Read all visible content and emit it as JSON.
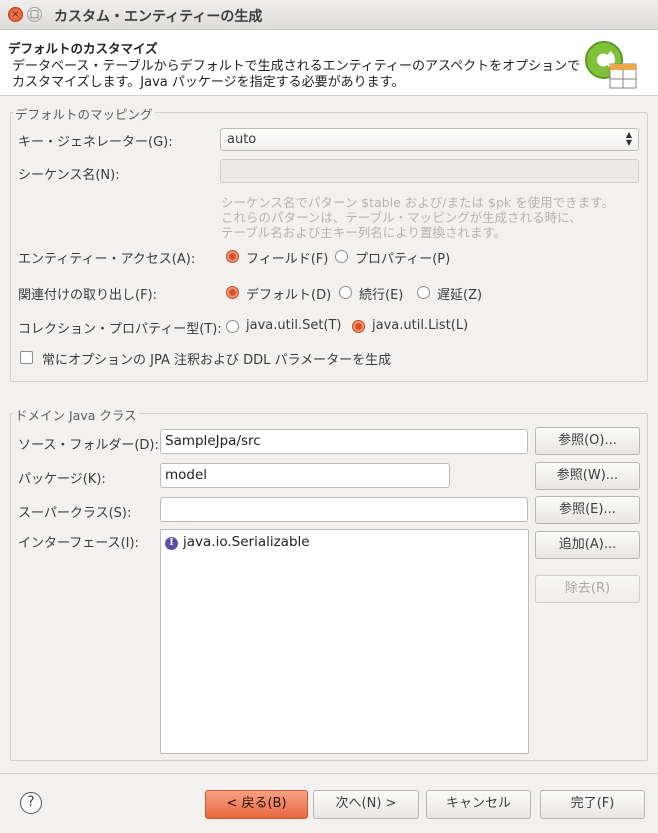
{
  "window": {
    "title": "カスタム・エンティティーの生成",
    "close_glyph": "×",
    "max_glyph": "□"
  },
  "banner": {
    "title": "デフォルトのカスタマイズ",
    "description": "データベース・テーブルからデフォルトで生成されるエンティティーのアスペクトをオプションでカスタマイズします。Java パッケージを指定する必要があります。",
    "logo_icon": "entity-generation-logo-icon"
  },
  "mapping": {
    "group_label": "デフォルトのマッピング",
    "key_generator_label": "キー・ジェネレーター(G):",
    "key_generator_value": "auto",
    "sequence_label": "シーケンス名(N):",
    "sequence_value": "",
    "sequence_hint_1": "シーケンス名でパターン $table および/または $pk を使用できます。",
    "sequence_hint_2": "これらのパターンは、テーブル・マッピングが生成される時に、",
    "sequence_hint_3": "テーブル名および主キー列名により置換されます。",
    "entity_access_label": "エンティティー・アクセス(A):",
    "entity_access_options": [
      "フィールド(F)",
      "プロパティー(P)"
    ],
    "fetch_label": "関連付けの取り出し(F):",
    "fetch_options": [
      "デフォルト(D)",
      "続行(E)",
      "遅延(Z)"
    ],
    "collection_label": "コレクション・プロパティー型(T):",
    "collection_options": [
      "java.util.Set(T)",
      "java.util.List(L)"
    ],
    "optional_checkbox_label": "常にオプションの JPA 注釈および DDL パラメーターを生成"
  },
  "domain": {
    "group_label": "ドメイン Java クラス",
    "source_folder_label": "ソース・フォルダー(D):",
    "source_folder_value": "SampleJpa/src",
    "source_browse": "参照(O)...",
    "package_label": "パッケージ(K):",
    "package_value": "model",
    "package_browse": "参照(W)...",
    "superclass_label": "スーパークラス(S):",
    "superclass_value": "",
    "superclass_browse": "参照(E)...",
    "interfaces_label": "インターフェース(I):",
    "interfaces": [
      "java.io.Serializable"
    ],
    "interface_icon_glyph": "I",
    "add_button": "追加(A)...",
    "remove_button": "除去(R)"
  },
  "footer": {
    "help_glyph": "?",
    "back": "< 戻る(B)",
    "next": "次へ(N) >",
    "cancel": "キャンセル",
    "finish": "完了(F)"
  },
  "colors": {
    "accent": "#e8683f",
    "interface_icon": "#5b4fa8"
  }
}
